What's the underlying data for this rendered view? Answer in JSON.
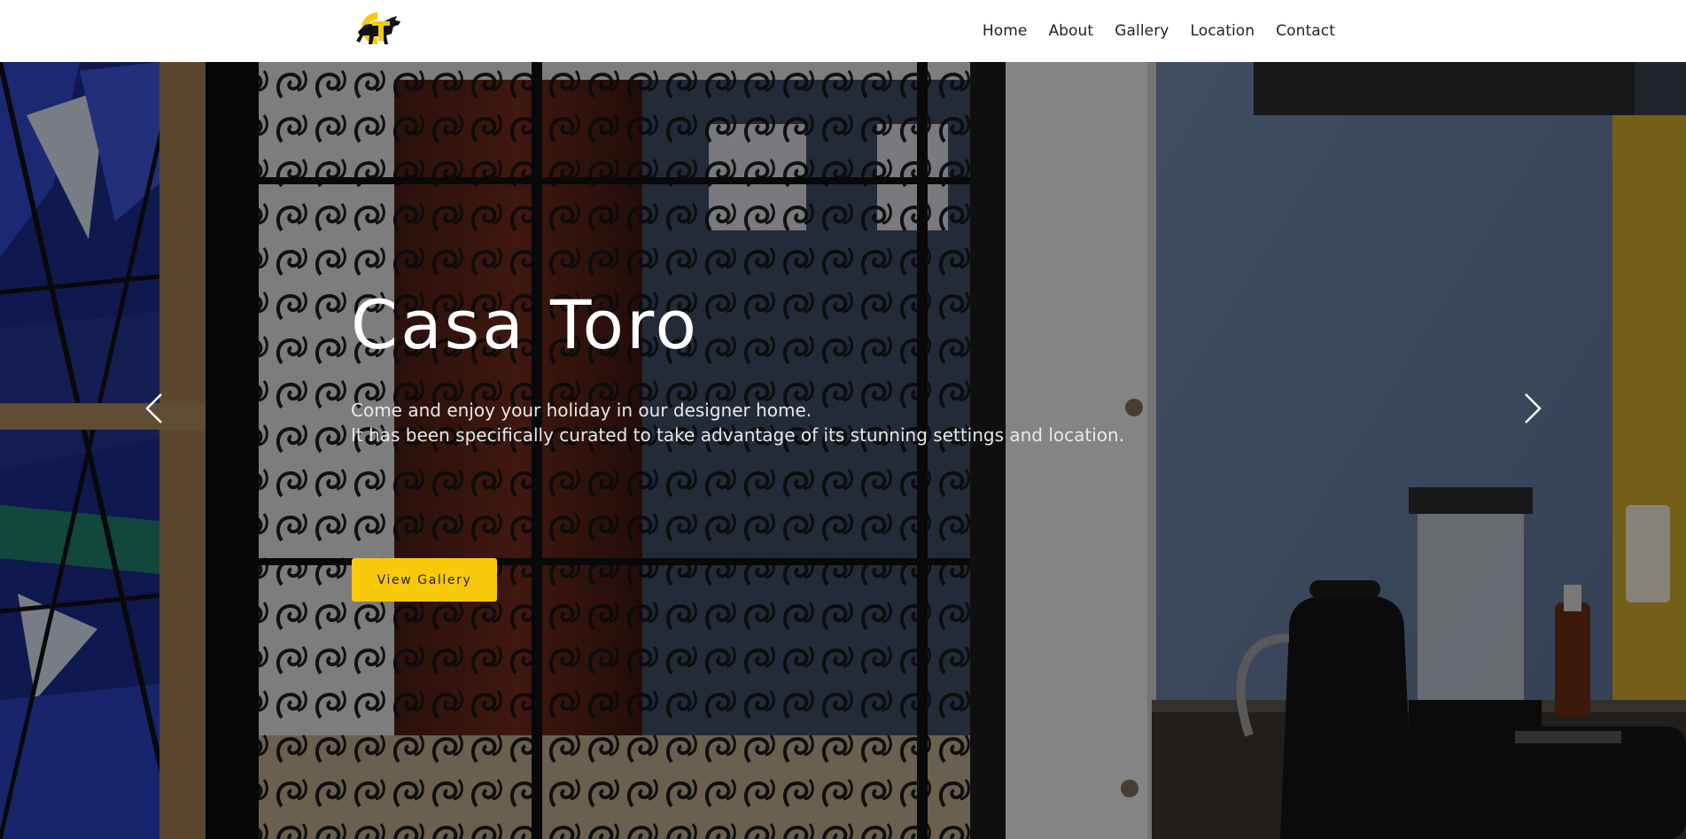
{
  "header": {
    "logo_icon": "bull-logo-icon",
    "brand_colors": {
      "yellow": "#f8c90b",
      "black": "#111111"
    },
    "nav": [
      {
        "label": "Home"
      },
      {
        "label": "About"
      },
      {
        "label": "Gallery"
      },
      {
        "label": "Location"
      },
      {
        "label": "Contact"
      }
    ]
  },
  "hero": {
    "title": "Casa Toro",
    "subtitle_line1": "Come and enjoy your holiday in our designer home.",
    "subtitle_line2": "It has been specifically curated to take advantage of its stunning settings and location.",
    "cta_label": "View Gallery",
    "cta_color": "#f8c90b",
    "prev_icon": "chevron-left-icon",
    "next_icon": "chevron-right-icon"
  }
}
